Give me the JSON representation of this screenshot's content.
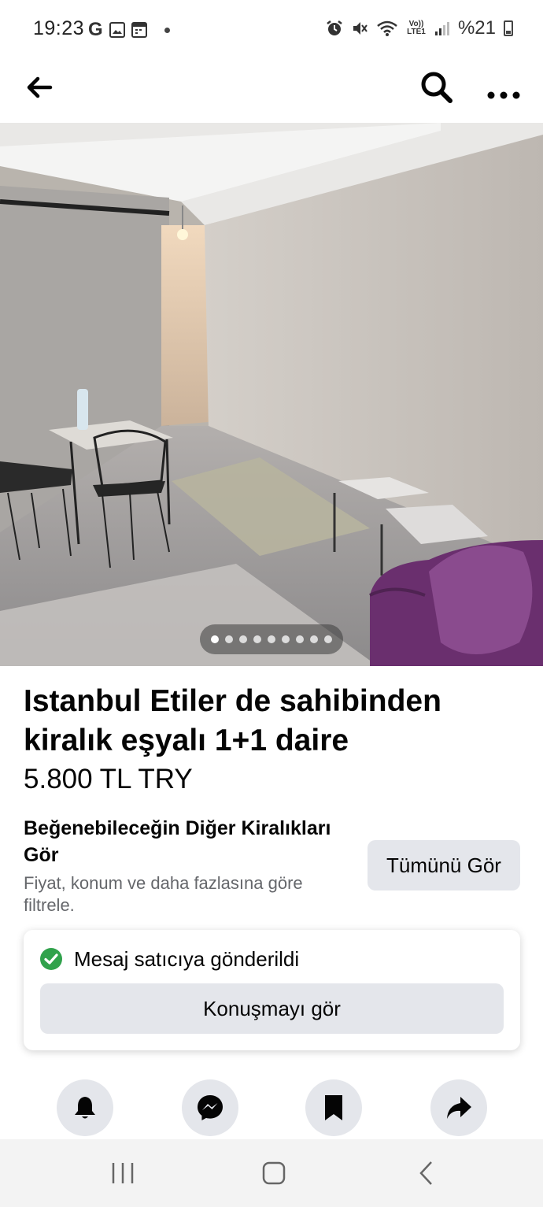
{
  "status_bar": {
    "time": "19:23",
    "left_icons": [
      "google-icon",
      "gallery-icon",
      "calendar-icon",
      "dot-icon"
    ],
    "right_icons": [
      "alarm-icon",
      "mute-icon",
      "wifi-icon",
      "volte-icon",
      "signal-icon"
    ],
    "volte_label": "Vo)) LTE1",
    "battery": "%21"
  },
  "header": {
    "back_icon": "arrow-left-icon",
    "search_icon": "search-icon",
    "more_icon": "more-horizontal-icon"
  },
  "gallery": {
    "photo_count": 9,
    "active_index": 0
  },
  "listing": {
    "title": "Istanbul Etiler de sahibinden kiralık eşyalı 1+1 daire",
    "price": "5.800 TL TRY"
  },
  "similar": {
    "heading": "Beğenebileceğin Diğer Kiralıkları Gör",
    "subtext": "Fiyat, konum ve daha fazlasına göre filtrele.",
    "button_label": "Tümünü Gör"
  },
  "message_card": {
    "status_text": "Mesaj satıcıya gönderildi",
    "button_label": "Konuşmayı gör",
    "status_color": "#31a24c"
  },
  "actions": [
    "bell-icon",
    "messenger-icon",
    "bookmark-icon",
    "share-icon"
  ],
  "nav": [
    "recent-apps-icon",
    "home-icon",
    "back-icon"
  ]
}
